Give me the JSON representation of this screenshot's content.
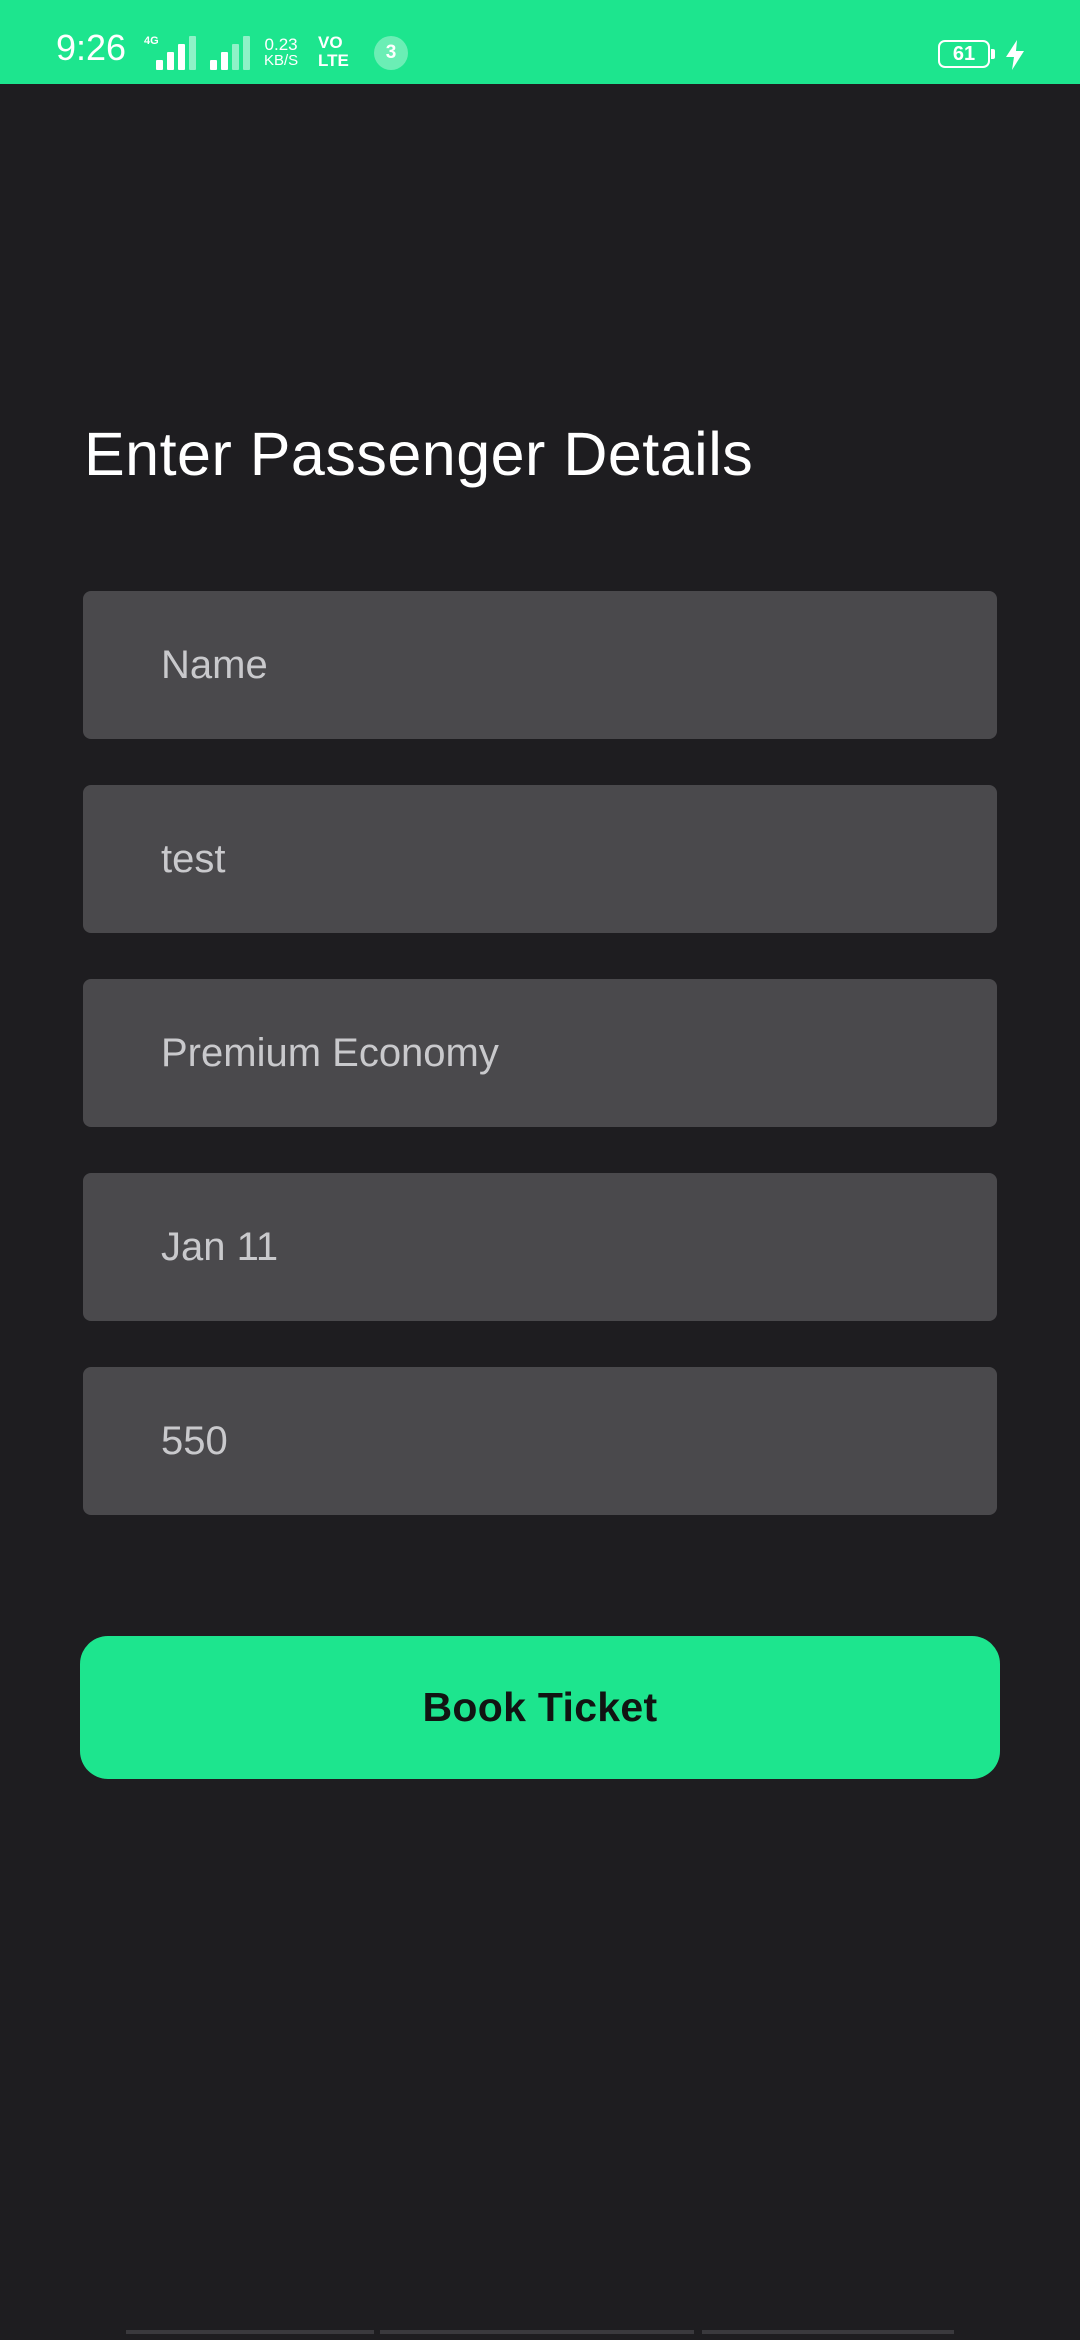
{
  "status_bar": {
    "time": "9:26",
    "network_type": "4G",
    "data_speed_value": "0.23",
    "data_speed_unit": "KB/S",
    "volte_top": "VO",
    "volte_bottom": "LTE",
    "notification_count": "3",
    "battery_level": "61",
    "accent_color": "#1de58e"
  },
  "page": {
    "title": "Enter Passenger Details"
  },
  "form": {
    "fields": [
      {
        "name": "name-field",
        "value": "Name"
      },
      {
        "name": "field-2",
        "value": "test"
      },
      {
        "name": "class-field",
        "value": "Premium Economy"
      },
      {
        "name": "date-field",
        "value": "Jan 11"
      },
      {
        "name": "price-field",
        "value": "550"
      }
    ]
  },
  "actions": {
    "book_label": "Book Ticket"
  }
}
